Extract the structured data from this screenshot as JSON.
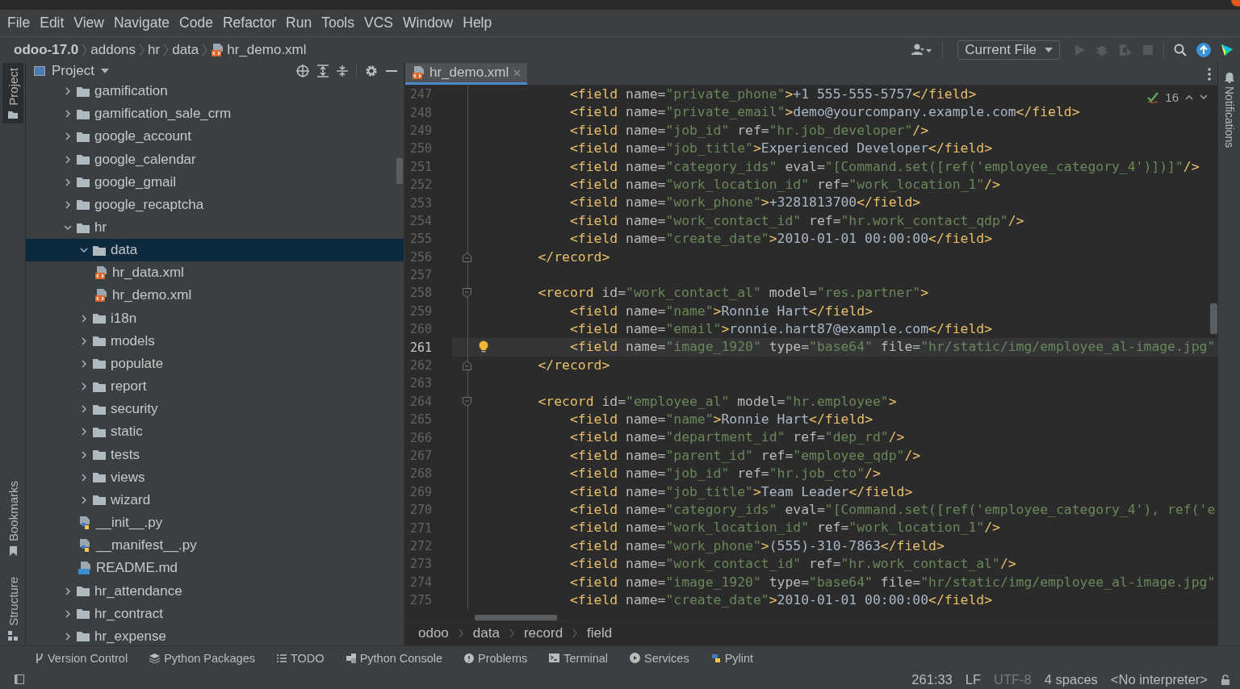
{
  "menu": [
    {
      "label": "File"
    },
    {
      "label": "Edit"
    },
    {
      "label": "View"
    },
    {
      "label": "Navigate"
    },
    {
      "label": "Code"
    },
    {
      "label": "Refactor"
    },
    {
      "label": "Run"
    },
    {
      "label": "Tools"
    },
    {
      "label": "VCS"
    },
    {
      "label": "Window"
    },
    {
      "label": "Help"
    }
  ],
  "nav": {
    "crumbs": [
      {
        "label": "odoo-17.0",
        "kind": "project"
      },
      {
        "label": "addons",
        "kind": "folder"
      },
      {
        "label": "hr",
        "kind": "folder"
      },
      {
        "label": "data",
        "kind": "folder"
      },
      {
        "label": "hr_demo.xml",
        "kind": "xml"
      }
    ],
    "run_config": "Current File"
  },
  "left_tabs": [
    {
      "label": "Project",
      "kind": "project",
      "selected": true
    },
    {
      "label": "Bookmarks",
      "kind": "bookmarks",
      "selected": false
    },
    {
      "label": "Structure",
      "kind": "structure",
      "selected": false
    }
  ],
  "project": {
    "title": "Project",
    "tree": [
      {
        "label": "gamification",
        "kind": "folder",
        "expanded": false,
        "selected": false
      },
      {
        "label": "gamification_sale_crm",
        "kind": "folder",
        "expanded": false,
        "selected": false
      },
      {
        "label": "google_account",
        "kind": "folder",
        "expanded": false,
        "selected": false
      },
      {
        "label": "google_calendar",
        "kind": "folder",
        "expanded": false,
        "selected": false
      },
      {
        "label": "google_gmail",
        "kind": "folder",
        "expanded": false,
        "selected": false
      },
      {
        "label": "google_recaptcha",
        "kind": "folder",
        "expanded": false,
        "selected": false
      },
      {
        "label": "hr",
        "kind": "folder",
        "expanded": true,
        "selected": false,
        "children": [
          {
            "label": "data",
            "kind": "folder",
            "expanded": true,
            "selected": true,
            "children": [
              {
                "label": "hr_data.xml",
                "kind": "xml",
                "selected": false
              },
              {
                "label": "hr_demo.xml",
                "kind": "xml",
                "selected": false
              }
            ]
          },
          {
            "label": "i18n",
            "kind": "folder",
            "expanded": false,
            "selected": false
          },
          {
            "label": "models",
            "kind": "folder",
            "expanded": false,
            "selected": false
          },
          {
            "label": "populate",
            "kind": "folder",
            "expanded": false,
            "selected": false
          },
          {
            "label": "report",
            "kind": "folder",
            "expanded": false,
            "selected": false
          },
          {
            "label": "security",
            "kind": "folder",
            "expanded": false,
            "selected": false
          },
          {
            "label": "static",
            "kind": "folder",
            "expanded": false,
            "selected": false
          },
          {
            "label": "tests",
            "kind": "folder",
            "expanded": false,
            "selected": false
          },
          {
            "label": "views",
            "kind": "folder",
            "expanded": false,
            "selected": false
          },
          {
            "label": "wizard",
            "kind": "folder",
            "expanded": false,
            "selected": false
          },
          {
            "label": "__init__.py",
            "kind": "python",
            "selected": false
          },
          {
            "label": "__manifest__.py",
            "kind": "python",
            "selected": false
          },
          {
            "label": "README.md",
            "kind": "markdown",
            "selected": false
          }
        ]
      },
      {
        "label": "hr_attendance",
        "kind": "folder",
        "expanded": false,
        "selected": false
      },
      {
        "label": "hr_contract",
        "kind": "folder",
        "expanded": false,
        "selected": false
      },
      {
        "label": "hr_expense",
        "kind": "folder",
        "expanded": false,
        "selected": false
      }
    ]
  },
  "editor": {
    "tabs": [
      {
        "label": "hr_demo.xml",
        "selected": true
      }
    ],
    "problems": "16",
    "lines": [
      {
        "number": "247",
        "code": "        <field name=\"private_phone\">+1 555-555-5757</field>",
        "current": false,
        "bulb": false
      },
      {
        "number": "248",
        "code": "        <field name=\"private_email\">demo@yourcompany.example.com</field>",
        "current": false,
        "bulb": false
      },
      {
        "number": "249",
        "code": "        <field name=\"job_id\" ref=\"hr.job_developer\"/>",
        "current": false,
        "bulb": false
      },
      {
        "number": "250",
        "code": "        <field name=\"job_title\">Experienced Developer</field>",
        "current": false,
        "bulb": false
      },
      {
        "number": "251",
        "code": "        <field name=\"category_ids\" eval=\"[Command.set([ref('employee_category_4')])]\"/>",
        "current": false,
        "bulb": false
      },
      {
        "number": "252",
        "code": "        <field name=\"work_location_id\" ref=\"work_location_1\"/>",
        "current": false,
        "bulb": false
      },
      {
        "number": "253",
        "code": "        <field name=\"work_phone\">+3281813700</field>",
        "current": false,
        "bulb": false
      },
      {
        "number": "254",
        "code": "        <field name=\"work_contact_id\" ref=\"hr.work_contact_qdp\"/>",
        "current": false,
        "bulb": false
      },
      {
        "number": "255",
        "code": "        <field name=\"create_date\">2010-01-01 00:00:00</field>",
        "current": false,
        "bulb": false
      },
      {
        "number": "256",
        "code": "    </record>",
        "kind": "fold_end",
        "current": false,
        "bulb": false
      },
      {
        "number": "257",
        "current": false,
        "bulb": false
      },
      {
        "number": "258",
        "code": "    <record id=\"work_contact_al\" model=\"res.partner\">",
        "kind": "fold_start",
        "current": false,
        "bulb": false
      },
      {
        "number": "259",
        "code": "        <field name=\"name\">Ronnie Hart</field>",
        "current": false,
        "bulb": false
      },
      {
        "number": "260",
        "code": "        <field name=\"email\">ronnie.hart87@example.com</field>",
        "current": false,
        "bulb": false
      },
      {
        "number": "261",
        "code": "        <field name=\"image_1920\" type=\"base64\" file=\"hr/static/img/employee_al-image.jpg\"",
        "current": true,
        "bulb": true
      },
      {
        "number": "262",
        "code": "    </record>",
        "kind": "fold_end",
        "current": false,
        "bulb": false
      },
      {
        "number": "263",
        "current": false,
        "bulb": false
      },
      {
        "number": "264",
        "code": "    <record id=\"employee_al\" model=\"hr.employee\">",
        "kind": "fold_start",
        "current": false,
        "bulb": false
      },
      {
        "number": "265",
        "code": "        <field name=\"name\">Ronnie Hart</field>",
        "current": false,
        "bulb": false
      },
      {
        "number": "266",
        "code": "        <field name=\"department_id\" ref=\"dep_rd\"/>",
        "current": false,
        "bulb": false
      },
      {
        "number": "267",
        "code": "        <field name=\"parent_id\" ref=\"employee_qdp\"/>",
        "current": false,
        "bulb": false
      },
      {
        "number": "268",
        "code": "        <field name=\"job_id\" ref=\"hr.job_cto\"/>",
        "current": false,
        "bulb": false
      },
      {
        "number": "269",
        "code": "        <field name=\"job_title\">Team Leader</field>",
        "current": false,
        "bulb": false
      },
      {
        "number": "270",
        "code": "        <field name=\"category_ids\" eval=\"[Command.set([ref('employee_category_4'), ref('e",
        "current": false,
        "bulb": false
      },
      {
        "number": "271",
        "code": "        <field name=\"work_location_id\" ref=\"work_location_1\"/>",
        "current": false,
        "bulb": false
      },
      {
        "number": "272",
        "code": "        <field name=\"work_phone\">(555)-310-7863</field>",
        "current": false,
        "bulb": false
      },
      {
        "number": "273",
        "code": "        <field name=\"work_contact_id\" ref=\"hr.work_contact_al\"/>",
        "current": false,
        "bulb": false
      },
      {
        "number": "274",
        "code": "        <field name=\"image_1920\" type=\"base64\" file=\"hr/static/img/employee_al-image.jpg\"",
        "current": false,
        "bulb": false
      },
      {
        "number": "275",
        "code": "        <field name=\"create_date\">2010-01-01 00:00:00</field>",
        "current": false,
        "bulb": false
      }
    ],
    "breadcrumbs": [
      "odoo",
      "data",
      "record",
      "field"
    ]
  },
  "right_tabs": [
    {
      "label": "Notifications"
    }
  ],
  "tool_windows": [
    {
      "label": "Version Control",
      "kind": "vcs"
    },
    {
      "label": "Python Packages",
      "kind": "packages"
    },
    {
      "label": "TODO",
      "kind": "todo"
    },
    {
      "label": "Python Console",
      "kind": "console"
    },
    {
      "label": "Problems",
      "kind": "problems"
    },
    {
      "label": "Terminal",
      "kind": "terminal"
    },
    {
      "label": "Services",
      "kind": "services"
    },
    {
      "label": "Pylint",
      "kind": "pylint"
    }
  ],
  "status": [
    {
      "label": "261:33",
      "disabled": false
    },
    {
      "label": "LF",
      "disabled": false
    },
    {
      "label": "UTF-8",
      "disabled": true
    },
    {
      "label": "4 spaces",
      "disabled": false
    },
    {
      "label": "<No interpreter>",
      "disabled": false
    }
  ]
}
